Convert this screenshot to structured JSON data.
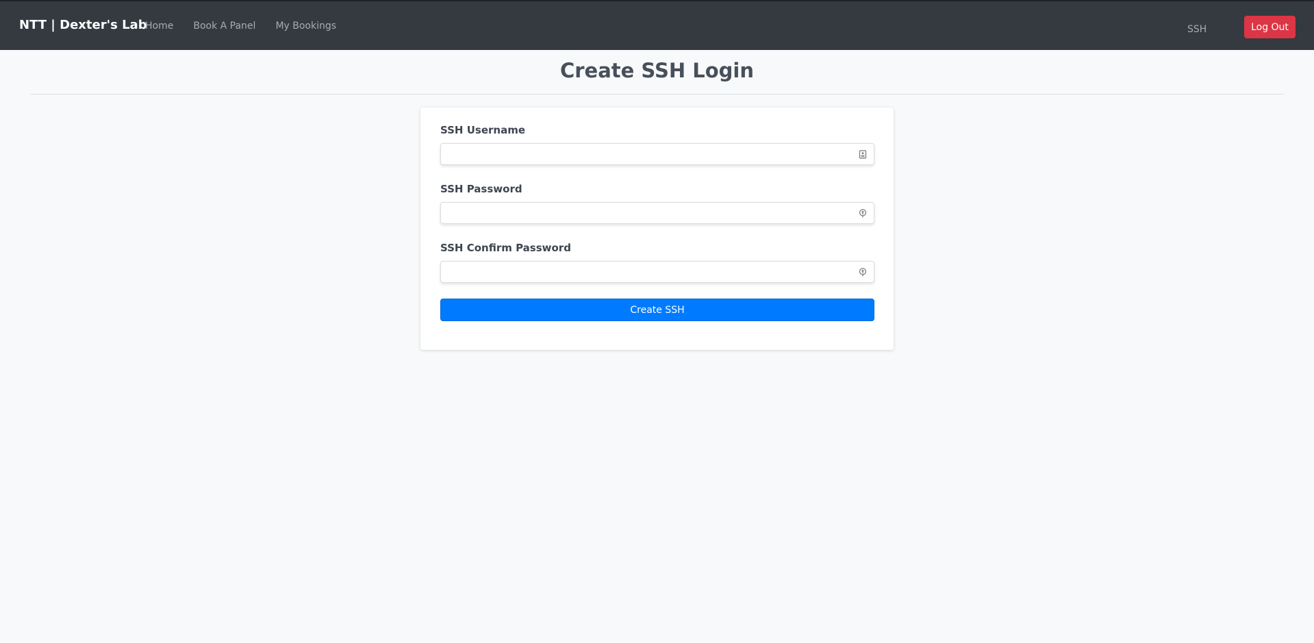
{
  "navbar": {
    "brand": "NTT | Dexter's Lab",
    "links": [
      {
        "label": "Home"
      },
      {
        "label": "Book A Panel"
      },
      {
        "label": "My Bookings"
      }
    ],
    "ssh_label": "SSH",
    "logout_label": "Log Out"
  },
  "page": {
    "title": "Create SSH Login"
  },
  "form": {
    "username": {
      "label": "SSH Username",
      "value": "",
      "icon": "id-card-icon"
    },
    "password": {
      "label": "SSH Password",
      "value": "",
      "icon": "key-icon"
    },
    "confirm_password": {
      "label": "SSH Confirm Password",
      "value": "",
      "icon": "key-icon"
    },
    "submit_label": "Create SSH"
  },
  "colors": {
    "navbar_bg": "#343a40",
    "page_bg": "#f8f9fa",
    "logout_bg": "#dc3545",
    "primary": "#007bff"
  }
}
